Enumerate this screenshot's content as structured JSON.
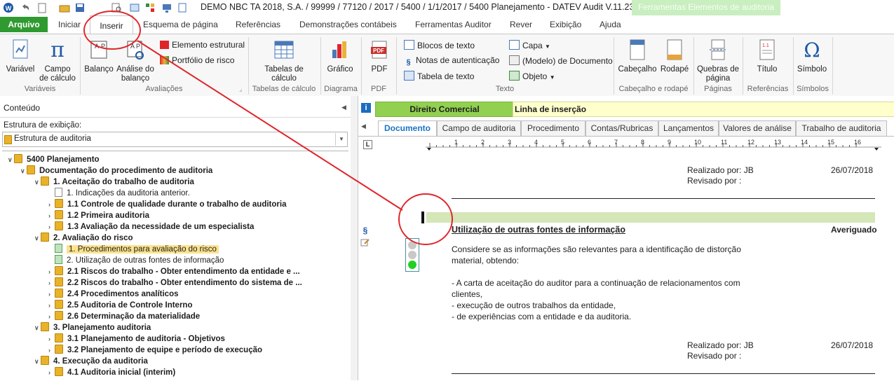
{
  "window": {
    "title": "DEMO NBC TA 2018, S.A. / 99999 / 77120 / 2017 / 5400 / 1/1/2017 / 5400 Planejamento - DATEV Audit V.11.23",
    "context_tab_header": "Ferramentas Elementos de auditoria"
  },
  "ribbon_tabs": {
    "arquivo": "Arquivo",
    "iniciar": "Iniciar",
    "inserir": "Inserir",
    "esquema": "Esquema de página",
    "referencias": "Referências",
    "demonstracoes": "Demonstrações contábeis",
    "ferramentas": "Ferramentas Auditor",
    "rever": "Rever",
    "exibicao": "Exibição",
    "ajuda": "Ajuda"
  },
  "ribbon": {
    "variavel": "Variável",
    "campo_l1": "Campo",
    "campo_l2": "de cálculo",
    "group_variaveis": "Variáveis",
    "balanco": "Balanço",
    "analise_l1": "Análise do",
    "analise_l2": "balanço",
    "elemento_estrutural": "Elemento estrutural",
    "portfolio_risco": "Portfólio de risco",
    "group_avaliacoes": "Avaliações",
    "tabelas_l1": "Tabelas de",
    "tabelas_l2": "cálculo",
    "group_tabelas": "Tabelas de cálculo",
    "grafico": "Gráfico",
    "group_diagrama": "Diagrama",
    "pdf": "PDF",
    "group_pdf": "PDF",
    "blocos_texto": "Blocos de texto",
    "notas_autenticacao": "Notas de autenticação",
    "tabela_texto": "Tabela de texto",
    "capa": "Capa",
    "modelo_documento": "(Modelo) de Documento",
    "objeto": "Objeto",
    "group_texto": "Texto",
    "cabecalho": "Cabeçalho",
    "rodape": "Rodapé",
    "group_cab_rod": "Cabeçalho e rodapé",
    "quebras_l1": "Quebras de",
    "quebras_l2": "página",
    "group_paginas": "Páginas",
    "titulo": "Título",
    "group_referencias": "Referências",
    "simbolo": "Símbolo",
    "group_simbolos": "Símbolos"
  },
  "left_panel": {
    "header": "Conteúdo",
    "display_label": "Estrutura de exibição:",
    "display_value": "Estrutura de auditoria",
    "tree": [
      {
        "text": "5400 Planejamento",
        "bold": true
      },
      {
        "text": "Documentação do procedimento de auditoria",
        "bold": true
      },
      {
        "text": "1. Aceitação do trabalho de auditoria",
        "bold": true
      },
      {
        "text": "1. Indicações da auditoria anterior.",
        "bold": false
      },
      {
        "text": "1.1 Controle de qualidade durante o trabalho de auditoria",
        "bold": true
      },
      {
        "text": "1.2 Primeira auditoria",
        "bold": true
      },
      {
        "text": "1.3 Avaliação da necessidade de um especialista",
        "bold": true
      },
      {
        "text": "2. Avaliação do risco",
        "bold": true
      },
      {
        "text": "1. Procedimentos para avaliação do risco",
        "bold": false
      },
      {
        "text": "2. Utilização de outras fontes de informação",
        "bold": false
      },
      {
        "text": "2.1 Riscos do trabalho - Obter entendimento da entidade e ...",
        "bold": true
      },
      {
        "text": "2.2 Riscos do trabalho - Obter entendimento do sistema de ...",
        "bold": true
      },
      {
        "text": "2.4 Procedimentos analíticos",
        "bold": true
      },
      {
        "text": "2.5 Auditoria de Controle Interno",
        "bold": true
      },
      {
        "text": "2.6 Determinação da materialidade",
        "bold": true
      },
      {
        "text": "3. Planejamento auditoria",
        "bold": true
      },
      {
        "text": "3.1 Planejamento de auditoria - Objetivos",
        "bold": true
      },
      {
        "text": "3.2 Planejamento de equipe e período de execução",
        "bold": true
      },
      {
        "text": "4. Execução da auditoria",
        "bold": true
      },
      {
        "text": "4.1 Auditoria inicial (interim)",
        "bold": true
      }
    ]
  },
  "doc": {
    "area_label": "Direito Comercial",
    "insert_line": "Linha de inserção",
    "tabs": [
      "Documento",
      "Campo de auditoria",
      "Procedimento",
      "Contas/Rubricas",
      "Lançamentos",
      "Valores de análise",
      "Trabalho de auditoria"
    ],
    "ruler_numbers": [
      "1",
      "2",
      "3",
      "4",
      "5",
      "6",
      "7",
      "8",
      "9",
      "10",
      "11",
      "12",
      "13",
      "14",
      "15",
      "16"
    ],
    "realizado_1": "Realizado por: JB",
    "revisado_1": "Revisado por :",
    "date_1": "26/07/2018",
    "heading": "Utilização de outras fontes de informação",
    "status": "Averiguado",
    "para1_l1": "Considere se as informações são relevantes para a identificação de distorção",
    "para1_l2": "material, obtendo:",
    "bullet1_l1": "- A carta de aceitação do auditor para a continuação de relacionamentos com",
    "bullet1_l2": "clientes,",
    "bullet2": "- execução de outros trabalhos da entidade,",
    "bullet3": "- de experiências com a entidade e da auditoria.",
    "realizado_2": "Realizado por: JB",
    "revisado_2": "Revisado por :",
    "date_2": "26/07/2018"
  },
  "colors": {
    "ribbon_green": "#2f9a2f",
    "annotation_red": "#e0252a",
    "insert_bar": "#d5e6b8",
    "label_green": "#92d050"
  }
}
